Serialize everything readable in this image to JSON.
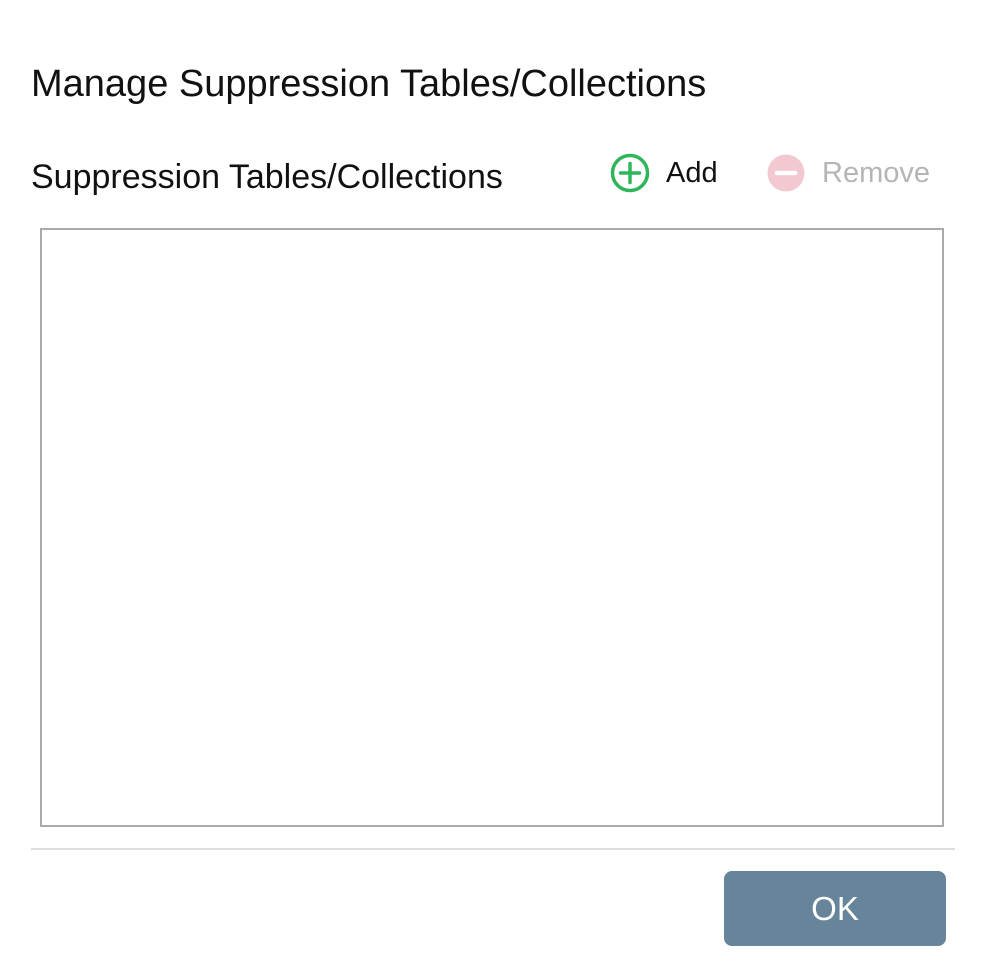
{
  "dialog": {
    "title": "Manage Suppression Tables/Collections"
  },
  "section": {
    "label": "Suppression Tables/Collections"
  },
  "toolbar": {
    "add_label": "Add",
    "add_icon": "plus-circle-icon",
    "add_color": "#2fb55a",
    "remove_label": "Remove",
    "remove_icon": "minus-circle-icon",
    "remove_color": "#f2c9d0",
    "remove_enabled": false
  },
  "list": {
    "items": []
  },
  "footer": {
    "ok_label": "OK",
    "ok_color": "#67859a"
  }
}
